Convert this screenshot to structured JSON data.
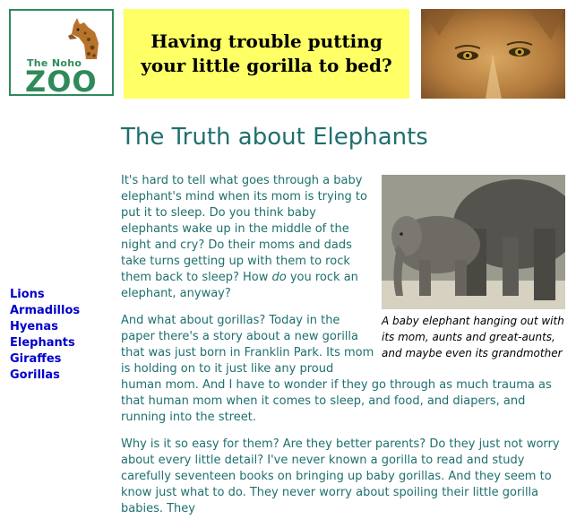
{
  "logo": {
    "line1": "The Noho",
    "line2": "ZOO"
  },
  "banner": {
    "line1": "Having trouble putting",
    "line2": "your little gorilla to bed?"
  },
  "sidebar": {
    "links": [
      {
        "label": "Lions"
      },
      {
        "label": "Armadillos"
      },
      {
        "label": "Hyenas"
      },
      {
        "label": "Elephants"
      },
      {
        "label": "Giraffes"
      },
      {
        "label": "Gorillas"
      }
    ]
  },
  "article": {
    "title": "The Truth about Elephants",
    "p1_before": "It's hard to tell what goes through a baby elephant's mind when its mom is trying to put it to sleep. Do you think baby elephants wake up in the middle of the night and cry? Do their moms and dads take turns getting up with them to rock them back to sleep? How ",
    "p1_em": "do",
    "p1_after": " you rock an elephant, anyway?",
    "p2": "And what about gorillas? Today in the paper there's a story about a new gorilla that was just born in Franklin Park. Its mom is holding on to it just like any proud human mom. And I have to wonder if they go through as much trauma as that human mom when it comes to sleep, and food, and diapers, and running into the street.",
    "p3": "Why is it so easy for them? Are they better parents? Do they just not worry about every little detail? I've never known a gorilla to read and study carefully seventeen books on bringing up baby gorillas. And they seem to know just what to do. They never worry about spoiling their little gorilla babies. They"
  },
  "figure": {
    "caption": "A baby elephant hanging out with its mom, aunts and great-aunts, and maybe even its grandmother"
  },
  "colors": {
    "accent": "#1f6f6f",
    "banner": "#ffff66",
    "link": "#0000cc",
    "logo": "#2f8a5a"
  }
}
